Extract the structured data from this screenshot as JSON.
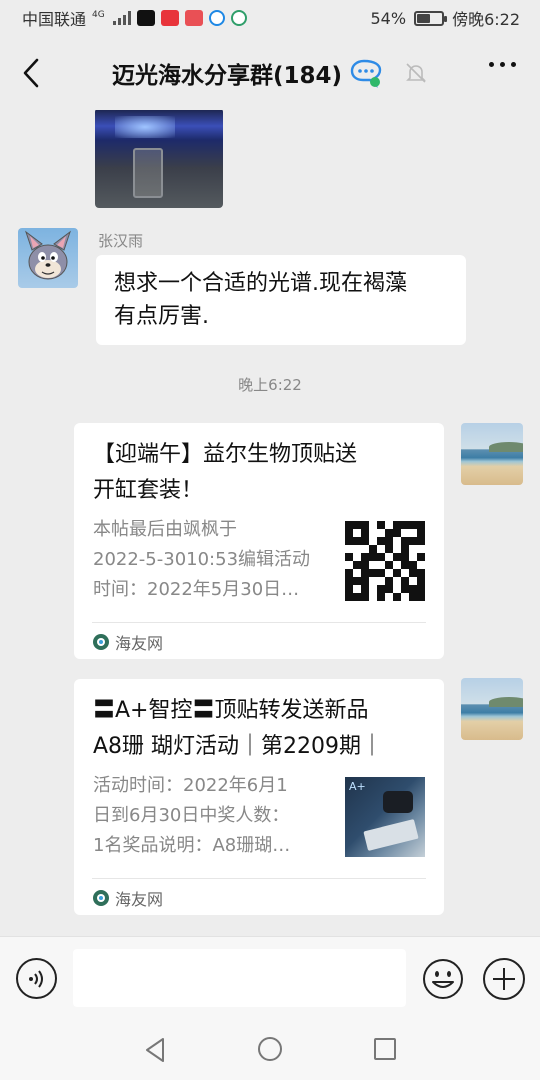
{
  "status_bar": {
    "carrier": "中国联通",
    "network": "4G",
    "battery_text": "54%",
    "battery_level": 0.54,
    "time": "傍晚6:22"
  },
  "header": {
    "title": "迈光海水分享群(184)",
    "back_icon": "chevron-left-icon",
    "chat_icon": "group-chat-icon",
    "mute_icon": "bell-muted-icon",
    "more_icon": "more-dots-icon"
  },
  "messages": {
    "incoming": {
      "sender": "张汉雨",
      "text_line1": "想求一个合适的光谱.现在褐藻",
      "text_line2": "有点厉害."
    },
    "time_divider": "晚上6:22",
    "cards": [
      {
        "title_line1": "【迎端午】益尔生物顶贴送",
        "title_line2": "开缸套装！",
        "desc_line1": "本帖最后由飒枫于",
        "desc_line2": "2022-5-3010:53编辑活动",
        "desc_line3": "时间：2022年5月30日…",
        "source": "海友网"
      },
      {
        "title_line1": "〓A+智控〓顶贴转发送新品",
        "title_line2": "A8珊 瑚灯活动｜第2209期｜",
        "desc_line1": "活动时间：2022年6月1",
        "desc_line2": "日到6月30日中奖人数：",
        "desc_line3": "1名奖品说明：A8珊瑚…",
        "source": "海友网"
      }
    ]
  },
  "input_bar": {
    "voice_icon": "voice-icon",
    "emoji_icon": "emoji-icon",
    "plus_icon": "plus-icon"
  },
  "nav_bar": {
    "back_icon": "nav-back-icon",
    "home_icon": "nav-home-icon",
    "recent_icon": "nav-recent-icon"
  }
}
